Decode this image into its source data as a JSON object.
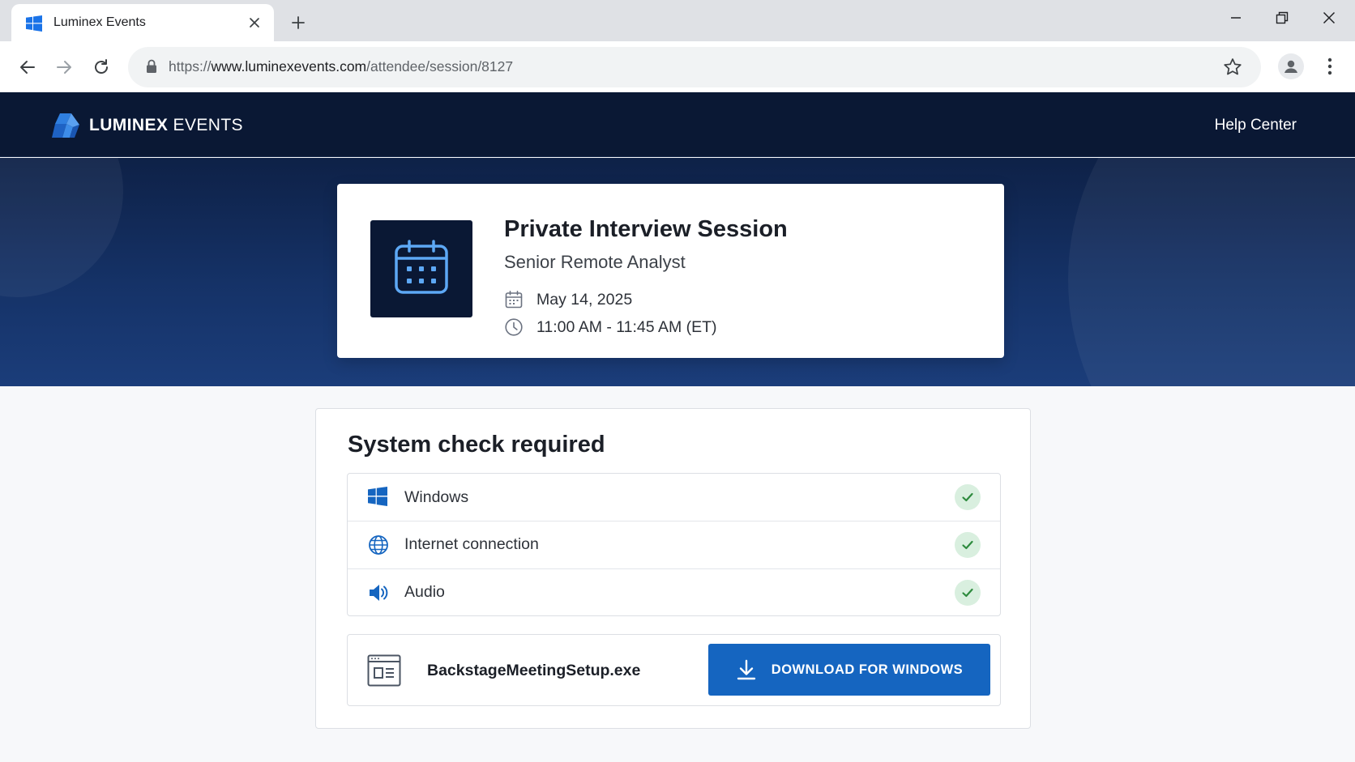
{
  "browser": {
    "tab_title": "Luminex Events",
    "url_scheme": "https://",
    "url_host": "www.luminexevents.com",
    "url_path": "/attendee/session/8127"
  },
  "header": {
    "brand_strong": "LUMINEX",
    "brand_light": " EVENTS",
    "help_link": "Help Center"
  },
  "session": {
    "title": "Private Interview Session",
    "subtitle": "Senior Remote Analyst",
    "date": "May 14, 2025",
    "time": "11:00 AM - 11:45 AM (ET)",
    "thumb_icon": "calendar-icon"
  },
  "system_check": {
    "title": "System check required",
    "items": [
      {
        "label": "Windows",
        "icon": "windows-icon",
        "status": "passed"
      },
      {
        "label": "Internet connection",
        "icon": "globe-icon",
        "status": "passed"
      },
      {
        "label": "Audio",
        "icon": "speaker-icon",
        "status": "passed"
      }
    ]
  },
  "download": {
    "file_name": "BackstageMeetingSetup.exe",
    "button_label": "DOWNLOAD FOR WINDOWS",
    "icon": "download-icon"
  },
  "colors": {
    "header_bg": "#0a1834",
    "hero_bg": "#153267",
    "accent": "#1565c0",
    "success": "#2e8b3e",
    "success_bg": "#d9efdf"
  }
}
